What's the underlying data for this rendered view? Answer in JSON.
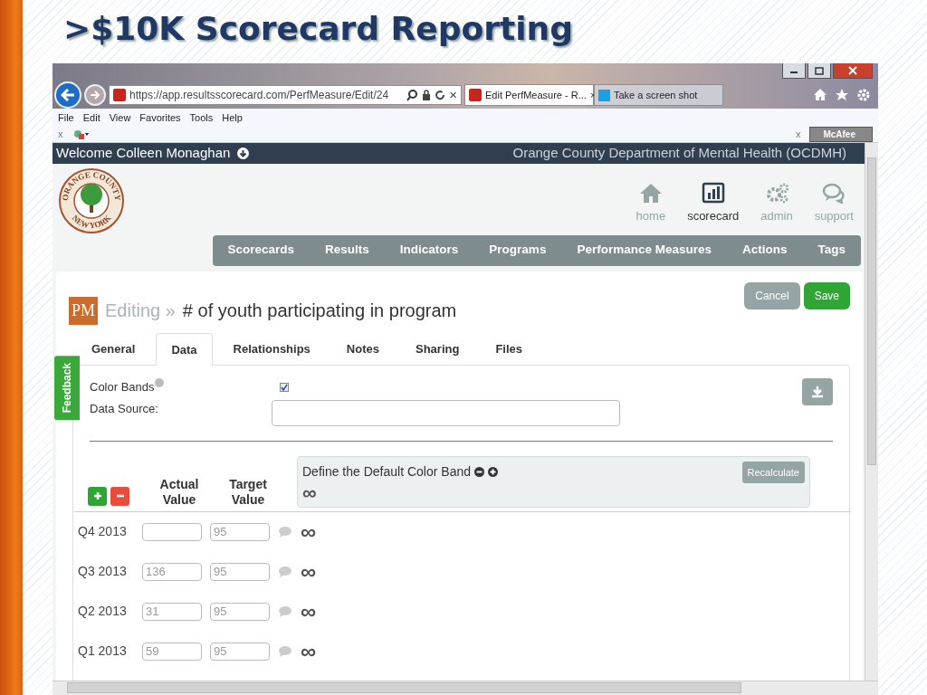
{
  "slide": {
    "title": ">$10K Scorecard Reporting"
  },
  "browser": {
    "address": "https://app.resultsscorecard.com/PerfMeasure/Edit/24",
    "close_glyph": "×",
    "tabs": [
      {
        "label": "Edit PerfMeasure - R...",
        "selected": true,
        "close": "×"
      },
      {
        "label": "Take a screen shot",
        "selected": false
      }
    ],
    "menu": [
      "File",
      "Edit",
      "View",
      "Favorites",
      "Tools",
      "Help"
    ],
    "toolbar_x": "x",
    "toolbar_x_right": "x",
    "addon": "McAfee"
  },
  "app": {
    "welcome": "Welcome Colleen Monaghan",
    "org": "Orange County Department of Mental Health (OCDMH)",
    "logo": {
      "top": "ORANGE COUNTY",
      "bottom": "NEW YORK"
    },
    "top_icons": [
      {
        "kind": "home",
        "label": "home",
        "selected": false
      },
      {
        "kind": "chart",
        "label": "scorecard",
        "selected": true
      },
      {
        "kind": "gears",
        "label": "admin",
        "selected": false
      },
      {
        "kind": "chat",
        "label": "support",
        "selected": false
      }
    ],
    "nav": [
      "Scorecards",
      "Results",
      "Indicators",
      "Programs",
      "Performance Measures",
      "Actions",
      "Tags"
    ],
    "badge": "PM",
    "breadcrumb": "Editing »",
    "title": "# of youth participating in program",
    "buttons": [
      {
        "label": "Cancel",
        "kind": "secondary"
      },
      {
        "label": "Save",
        "kind": "primary"
      }
    ],
    "tabs": [
      {
        "label": "General",
        "selected": false
      },
      {
        "label": "Data",
        "selected": true
      },
      {
        "label": "Relationships",
        "selected": false
      },
      {
        "label": "Notes",
        "selected": false
      },
      {
        "label": "Sharing",
        "selected": false
      },
      {
        "label": "Files",
        "selected": false
      }
    ],
    "feedback": "Feedback",
    "form": {
      "color_bands_label": "Color Bands",
      "color_bands_checked": true,
      "data_source_label": "Data Source:"
    },
    "color_band": {
      "title": "Define the Default Color Band",
      "recalculate": "Recalculate",
      "symbol": "∞"
    },
    "columns": [
      "Actual Value",
      "Target Value"
    ],
    "rows": [
      {
        "period": "Q4 2013",
        "target": "95",
        "symbol": "∞"
      },
      {
        "period": "Q3 2013",
        "actual": "136",
        "target": "95",
        "symbol": "∞"
      },
      {
        "period": "Q2 2013",
        "actual": "31",
        "target": "95",
        "symbol": "∞"
      },
      {
        "period": "Q1 2013",
        "actual": "59",
        "target": "95",
        "symbol": "∞"
      }
    ]
  }
}
